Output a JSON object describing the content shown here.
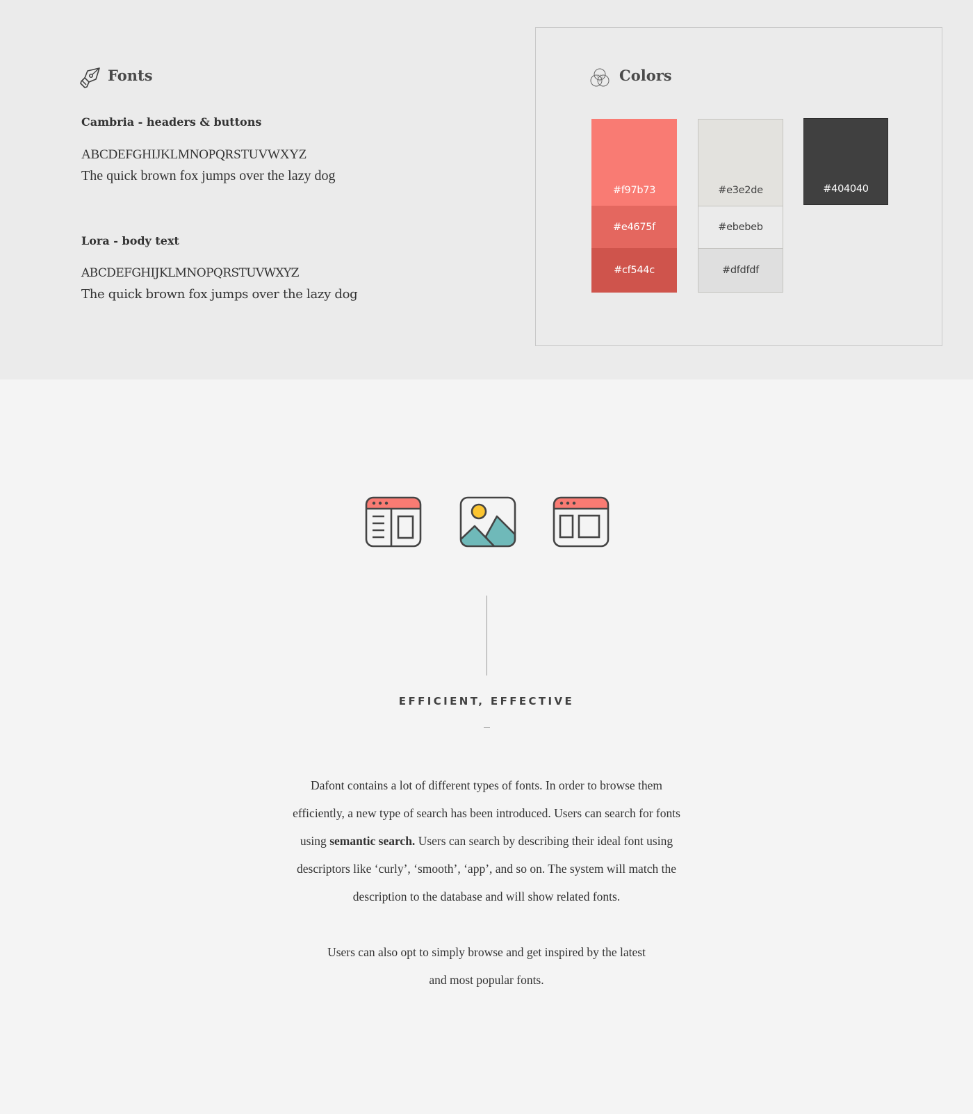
{
  "fonts": {
    "title": "Fonts",
    "icon": "pen-nib-icon",
    "items": [
      {
        "label": "Cambria - headers & buttons",
        "uppercase_sample": "ABCDEFGHIJKLMNOPQRSTUVWXYZ",
        "sentence_sample": "The quick brown fox jumps over the lazy dog"
      },
      {
        "label": "Lora - body text",
        "uppercase_sample": "ABCDEFGHIJKLMNOPQRSTUVWXYZ",
        "sentence_sample": "The quick brown fox jumps over the lazy dog"
      }
    ]
  },
  "colors": {
    "title": "Colors",
    "icon": "color-circles-icon",
    "reds": [
      {
        "label": "#f97b73",
        "hex": "#f97b73",
        "text_color": "#ffffff"
      },
      {
        "label": "#e4675f",
        "hex": "#e4675f",
        "text_color": "#ffffff"
      },
      {
        "label": "#cf544c",
        "hex": "#cf544c",
        "text_color": "#ffffff"
      }
    ],
    "grays": [
      {
        "label": "#e3e2de",
        "hex": "#e3e2de",
        "text_color": "#404040"
      },
      {
        "label": "#ebebeb",
        "hex": "#ebebeb",
        "text_color": "#404040"
      },
      {
        "label": "#dfdfdf",
        "hex": "#dfdfdf",
        "text_color": "#404040"
      }
    ],
    "dark": {
      "label": "#404040",
      "hex": "#404040",
      "text_color": "#ffffff"
    }
  },
  "icons": [
    {
      "name": "browser-sidebar-layout-icon",
      "accent": "#f97b73"
    },
    {
      "name": "image-landscape-icon",
      "sun": "#fbc531",
      "mountains": "#6fb9b9"
    },
    {
      "name": "browser-two-column-layout-icon",
      "accent": "#f97b73"
    }
  ],
  "section": {
    "heading": "EFFICIENT, EFFECTIVE",
    "paragraph1": {
      "line1": "Dafont contains a lot of different types of fonts. In order to browse them",
      "line2": "efficiently, a new type of search has been introduced. Users can search for fonts",
      "line3_pre": "using ",
      "line3_bold": "semantic search.",
      "line3_post": " Users can search by describing their ideal font using",
      "line4": "descriptors like ‘curly’, ‘smooth’, ‘app’, and so on. The system will match the",
      "line5": "description to the database and will show related fonts."
    },
    "paragraph2": {
      "line1": "Users can also opt to simply browse and get inspired by the latest",
      "line2": "and most popular fonts."
    }
  }
}
